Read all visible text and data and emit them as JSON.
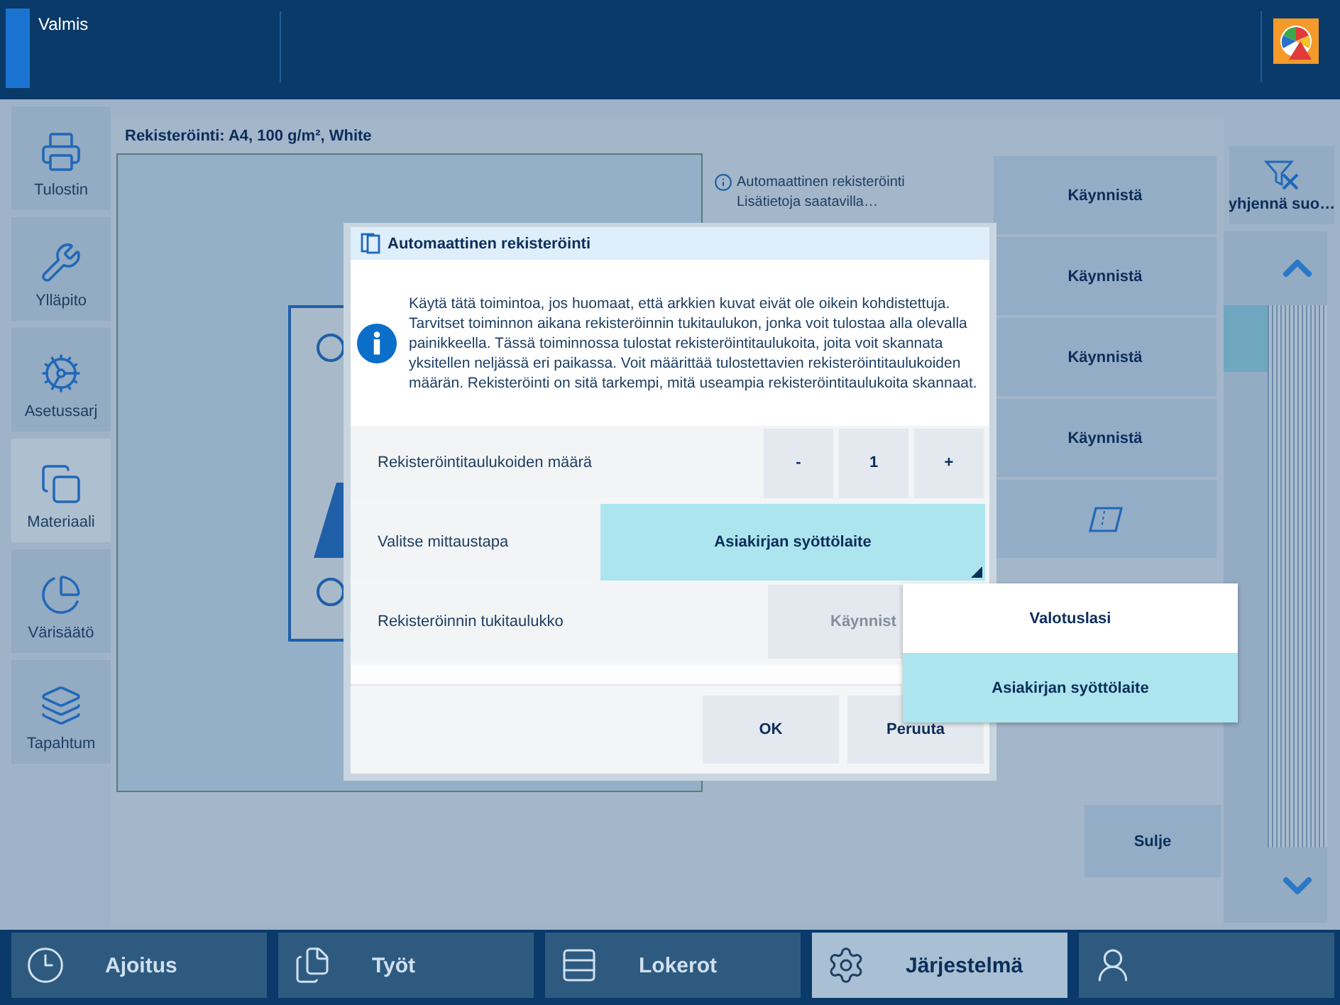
{
  "status_bar": {
    "status": "Valmis"
  },
  "sidebar": {
    "items": [
      {
        "label": "Tulostin",
        "selected": false
      },
      {
        "label": "Ylläpito",
        "selected": false
      },
      {
        "label": "Asetussarj",
        "selected": false
      },
      {
        "label": "Materiaali",
        "selected": true
      },
      {
        "label": "Värisäätö",
        "selected": false
      },
      {
        "label": "Tapahtum",
        "selected": false
      }
    ]
  },
  "toolbar": {
    "clear_filter": "yhjennä suo…"
  },
  "panel": {
    "title": "Rekisteröinti: A4, 100 g/m², White",
    "info": [
      "Automaattinen rekisteröinti",
      "Lisätietoja saatavilla…"
    ],
    "buttons": [
      "Käynnistä",
      "Käynnistä",
      "Käynnistä",
      "Käynnistä"
    ],
    "close": "Sulje"
  },
  "dialog": {
    "title": "Automaattinen rekisteröinti",
    "message": "Käytä tätä toimintoa, jos huomaat, että arkkien kuvat eivät ole oikein kohdistettuja. Tarvitset toiminnon aikana rekisteröinnin tukitaulukon, jonka voit tulostaa alla olevalla painikkeella. Tässä toiminnossa tulostat rekisteröintitaulukoita, joita voit skannata yksitellen neljässä eri paikassa. Voit määrittää tulostettavien rekisteröintitaulukoiden määrän. Rekisteröinti on sitä tarkempi, mitä useampia rekisteröintitaulukoita skannaat.",
    "rows": [
      {
        "kind": "stepper",
        "label": "Rekisteröintitaulukoiden määrä",
        "minus": "-",
        "value": "1",
        "plus": "+"
      },
      {
        "kind": "select",
        "label": "Valitse mittaustapa",
        "value": "Asiakirjan syöttölaite"
      },
      {
        "kind": "action",
        "label": "Rekisteröinnin tukitaulukko",
        "button": "Käynnist",
        "disabled": true
      }
    ],
    "buttons": [
      "OK",
      "Peruuta"
    ]
  },
  "dropdown": {
    "options": [
      {
        "label": "Valotuslasi",
        "selected": false
      },
      {
        "label": "Asiakirjan syöttölaite",
        "selected": true
      }
    ]
  },
  "nav_tabs": [
    {
      "label": "Ajoitus",
      "selected": false
    },
    {
      "label": "Työt",
      "selected": false
    },
    {
      "label": "Lokerot",
      "selected": false
    },
    {
      "label": "Järjestelmä",
      "selected": true
    },
    {
      "selected": false
    }
  ]
}
